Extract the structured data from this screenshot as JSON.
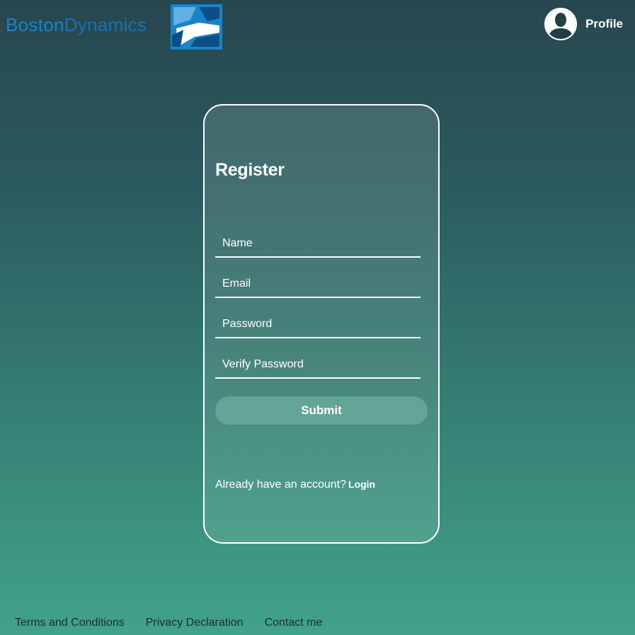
{
  "header": {
    "logo": {
      "word_a": "Boston",
      "word_b": "Dynamics",
      "colors": {
        "primary": "#1b83c7",
        "dark": "#0b4f86"
      }
    },
    "profile": {
      "label": "Profile",
      "icon": "user-avatar-icon"
    }
  },
  "register": {
    "title": "Register",
    "fields": {
      "name_placeholder": "Name",
      "email_placeholder": "Email",
      "password_placeholder": "Password",
      "verify_password_placeholder": "Verify Password"
    },
    "submit_label": "Submit",
    "switch_prompt": "Already have an account?",
    "login_label": "Login"
  },
  "footer": {
    "links": [
      "Terms and Conditions",
      "Privacy Declaration",
      "Contact me"
    ]
  },
  "colors": {
    "background_top": "#274650",
    "background_bottom": "#42a28a",
    "footer_text": "#1d2f2f"
  }
}
